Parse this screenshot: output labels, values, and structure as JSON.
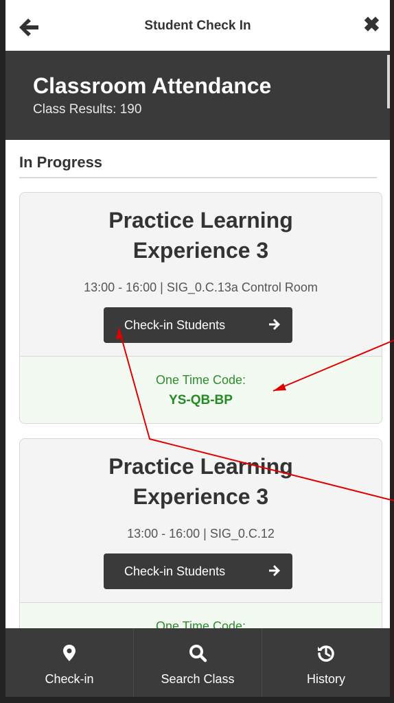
{
  "topbar": {
    "title": "Student Check In",
    "back_icon": "arrow-left-icon",
    "close_icon": "close-icon",
    "close_glyph": "✖"
  },
  "header": {
    "title": "Classroom Attendance",
    "subtitle": "Class Results: 190"
  },
  "section": {
    "title": "In Progress"
  },
  "cards": [
    {
      "title_line1": "Practice Learning",
      "title_line2": "Experience 3",
      "meta": "13:00 - 16:00 | SIG_0.C.13a Control Room",
      "button_label": "Check-in Students",
      "code_label": "One Time Code:",
      "code_value": "YS-QB-BP"
    },
    {
      "title_line1": "Practice Learning",
      "title_line2": "Experience 3",
      "meta": "13:00 - 16:00 | SIG_0.C.12",
      "button_label": "Check-in Students",
      "code_label": "One Time Code:",
      "code_value": ""
    }
  ],
  "nav": [
    {
      "label": "Check-in",
      "icon": "map-pin-icon"
    },
    {
      "label": "Search Class",
      "icon": "search-icon"
    },
    {
      "label": "History",
      "icon": "history-icon"
    }
  ],
  "colors": {
    "dark": "#3a3a3a",
    "code_green": "#228b22",
    "annotation_red": "#e00000"
  }
}
